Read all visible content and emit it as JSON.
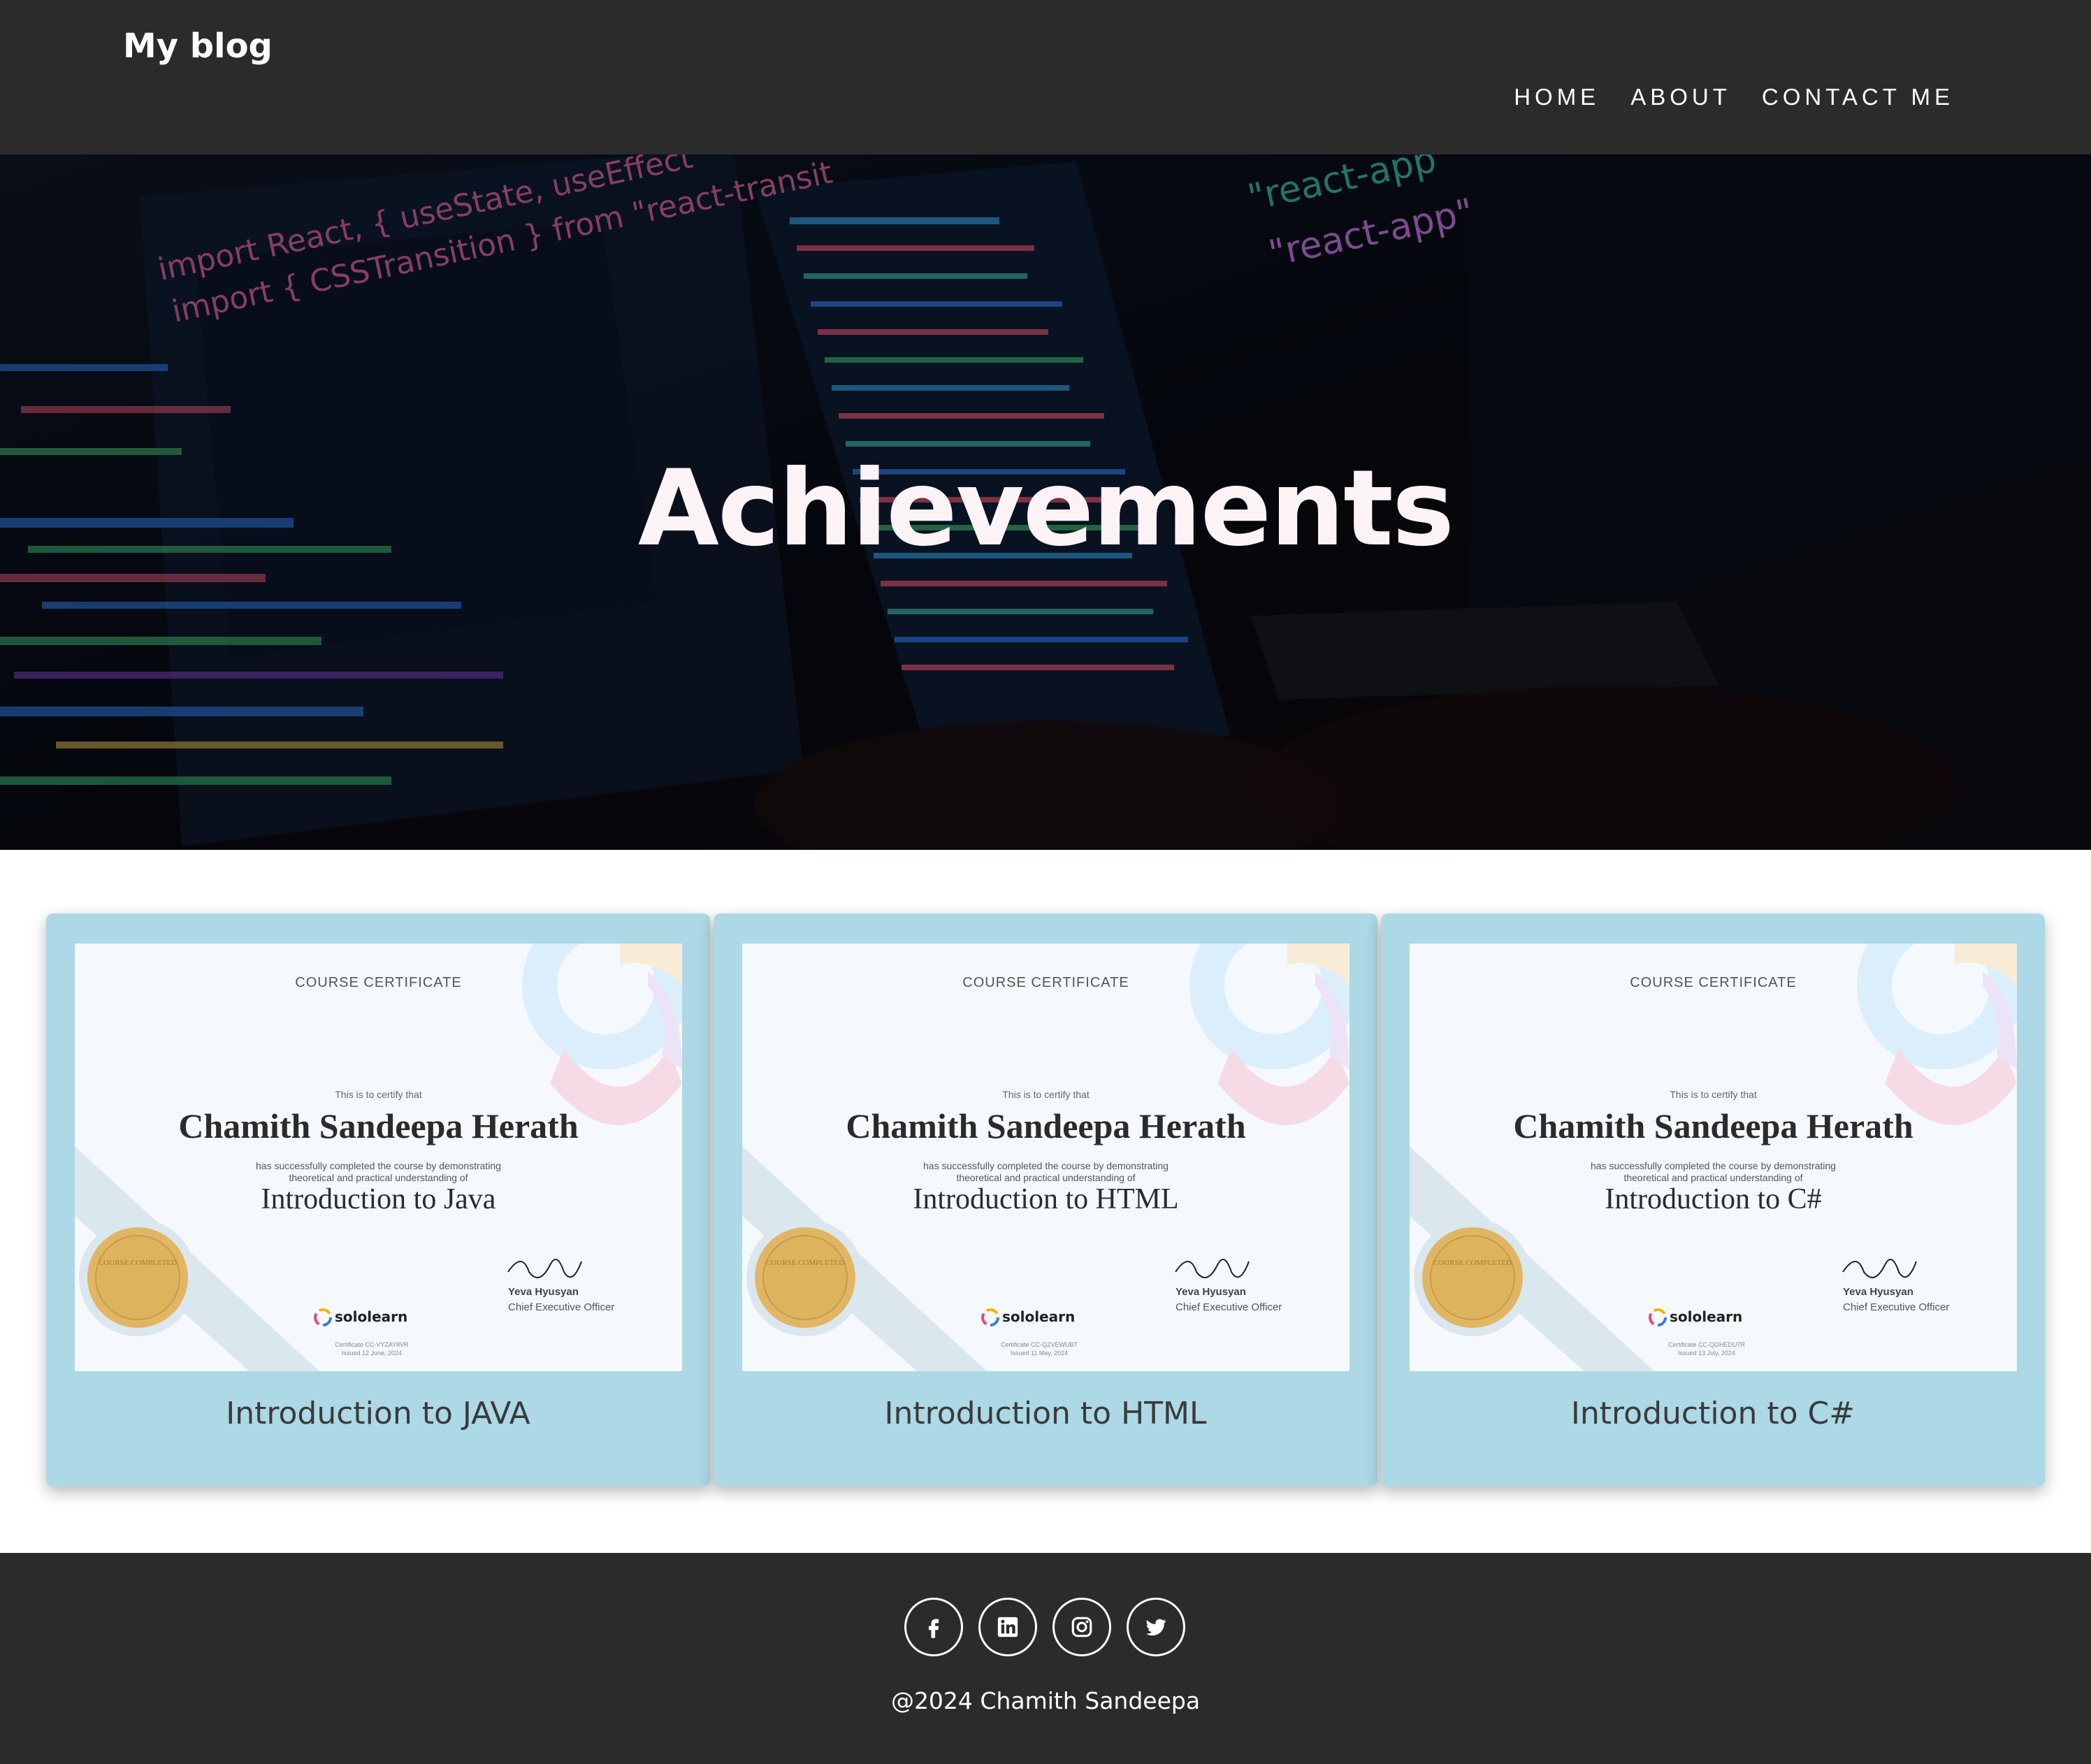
{
  "navbar": {
    "brand": "My blog",
    "links": [
      "HOME",
      "ABOUT",
      "CONTACT ME"
    ]
  },
  "hero": {
    "title": "Achievements",
    "code_lines": [
      "import React, { useState, useEffect",
      "import { CSSTransition } from \"react-transit",
      "\"react-app\"",
      "\"react-app\""
    ]
  },
  "cards": [
    {
      "title": "Introduction to JAVA",
      "certificate": {
        "heading": "COURSE CERTIFICATE",
        "certify": "This is to certify that",
        "name": "Chamith Sandeepa Herath",
        "description_line1": "has successfully completed the course by demonstrating",
        "description_line2": "theoretical and practical understanding of",
        "course": "Introduction to Java",
        "signer": "Yeva Hyusyan",
        "signer_role": "Chief Executive Officer",
        "brand": "sololearn",
        "certificate_id": "Certificate CC-VYZAY8VR",
        "issued": "Issued 12 June, 2024",
        "seal_text": "COURSE COMPLETED"
      }
    },
    {
      "title": "Introduction to HTML",
      "certificate": {
        "heading": "COURSE CERTIFICATE",
        "certify": "This is to certify that",
        "name": "Chamith Sandeepa Herath",
        "description_line1": "has successfully completed the course by demonstrating",
        "description_line2": "theoretical and practical understanding of",
        "course": "Introduction to HTML",
        "signer": "Yeva Hyusyan",
        "signer_role": "Chief Executive Officer",
        "brand": "sololearn",
        "certificate_id": "Certificate CC-QZVEWUBT",
        "issued": "Issued 11 May, 2024",
        "seal_text": "COURSE COMPLETED"
      }
    },
    {
      "title": "Introduction to C#",
      "certificate": {
        "heading": "COURSE CERTIFICATE",
        "certify": "This is to certify that",
        "name": "Chamith Sandeepa Herath",
        "description_line1": "has successfully completed the course by demonstrating",
        "description_line2": "theoretical and practical understanding of",
        "course": "Introduction to C#",
        "signer": "Yeva Hyusyan",
        "signer_role": "Chief Executive Officer",
        "brand": "sololearn",
        "certificate_id": "Certificate CC-QOHEDU7R",
        "issued": "Issued 13 July, 2024",
        "seal_text": "COURSE COMPLETED"
      }
    }
  ],
  "footer": {
    "socials": [
      "facebook-icon",
      "linkedin-icon",
      "instagram-icon",
      "twitter-icon"
    ],
    "copyright": "@2024 Chamith Sandeepa"
  },
  "colors": {
    "navbar_bg": "#2b2b2b",
    "card_bg": "#add8e6",
    "footer_bg": "#2b2b2b",
    "hero_title": "#fbf3f6"
  }
}
